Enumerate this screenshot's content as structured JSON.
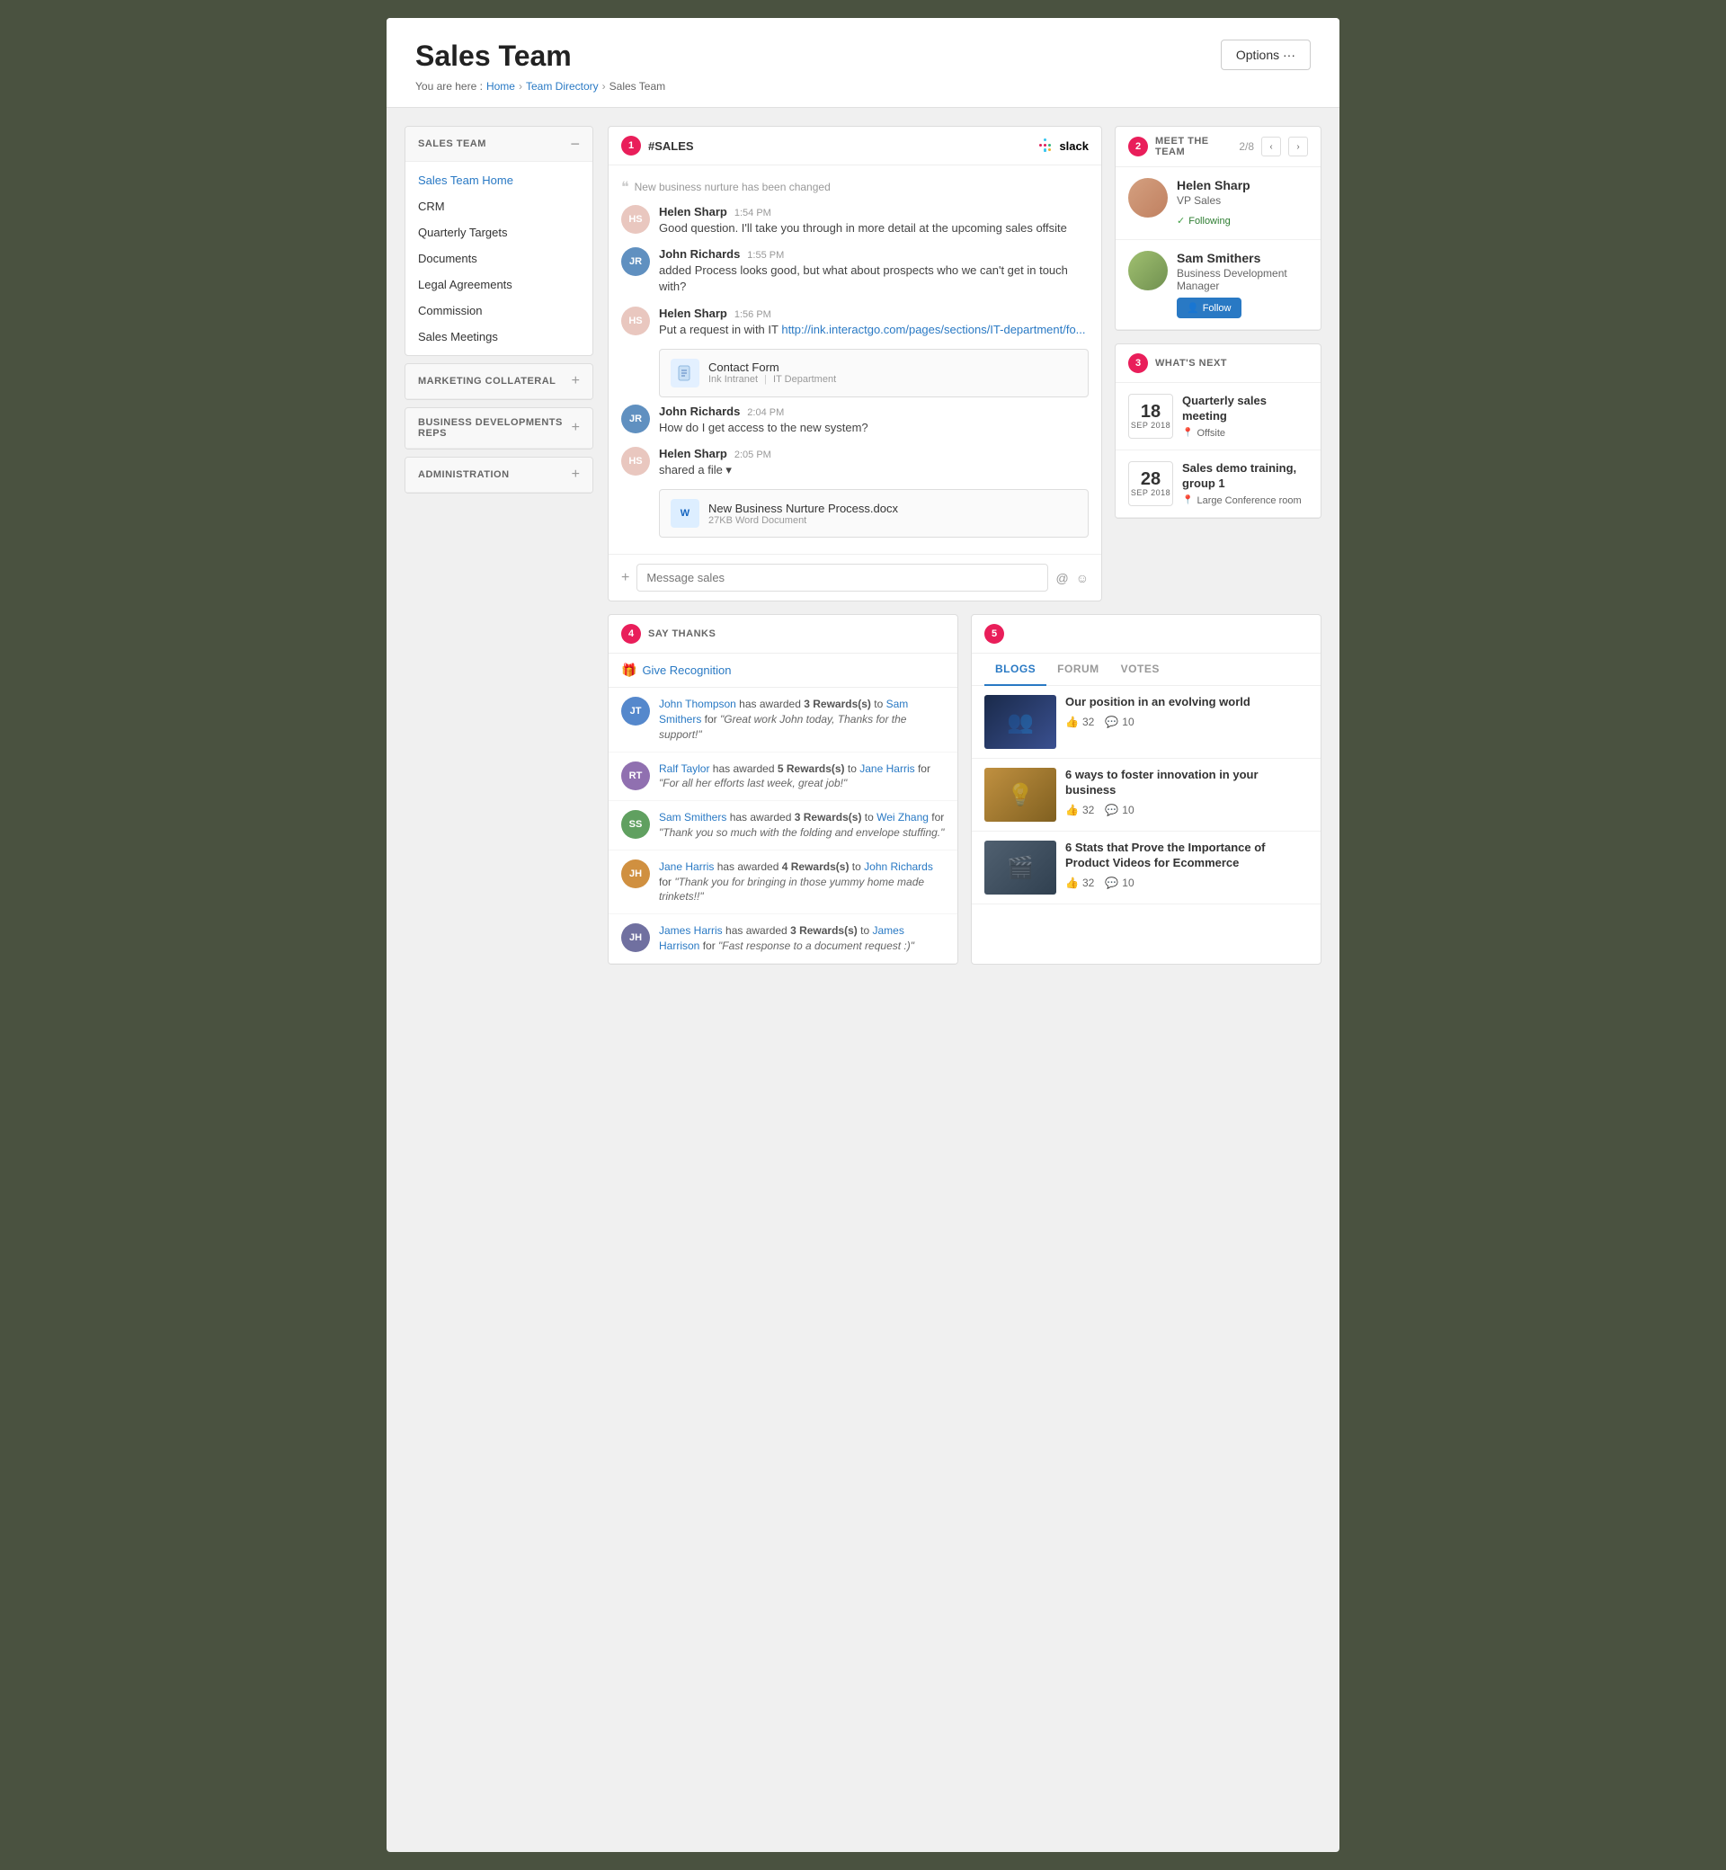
{
  "header": {
    "title": "Sales Team",
    "breadcrumb": {
      "prefix": "You are here :",
      "home": "Home",
      "team_dir": "Team Directory",
      "current": "Sales Team"
    },
    "options_label": "Options ···"
  },
  "sidebar": {
    "sections": [
      {
        "id": "sales-team",
        "title": "SALES TEAM",
        "toggle": "−",
        "items": [
          {
            "label": "Sales Team Home",
            "active": true
          },
          {
            "label": "CRM",
            "active": false
          },
          {
            "label": "Quarterly Targets",
            "active": false
          },
          {
            "label": "Documents",
            "active": false
          },
          {
            "label": "Legal Agreements",
            "active": false
          },
          {
            "label": "Commission",
            "active": false
          },
          {
            "label": "Sales Meetings",
            "active": false
          }
        ]
      },
      {
        "id": "marketing-collateral",
        "title": "MARKETING COLLATERAL",
        "toggle": "+",
        "items": []
      },
      {
        "id": "business-dev",
        "title": "BUSINESS DEVELOPMENTS REPS",
        "toggle": "+",
        "items": []
      },
      {
        "id": "administration",
        "title": "ADMINISTRATION",
        "toggle": "+",
        "items": []
      }
    ]
  },
  "slack": {
    "badge": "1",
    "channel": "#SALES",
    "system_msg": "New business nurture has been changed",
    "messages": [
      {
        "name": "Helen Sharp",
        "time": "1:54 PM",
        "text": "Good question. I'll take you through in more detail at the upcoming sales offsite"
      },
      {
        "name": "John Richards",
        "time": "1:55 PM",
        "text": "added Process looks good, but what about prospects who we can't get in touch with?"
      },
      {
        "name": "Helen Sharp",
        "time": "1:56 PM",
        "text": "Put a request in with IT http://ink.interactgo.com/pages/sections/IT-department/fo..."
      },
      {
        "name": "John Richards",
        "time": "2:04 PM",
        "text": "How do I get access to the new system?"
      },
      {
        "name": "Helen Sharp",
        "time": "2:05 PM",
        "text": "shared a file ▾"
      }
    ],
    "attachment_form": {
      "title": "Contact Form",
      "source": "Ink Intranet",
      "dept": "IT Department"
    },
    "attachment_doc": {
      "title": "New Business Nurture Process.docx",
      "size": "27KB Word Document"
    },
    "message_placeholder": "Message sales"
  },
  "meet_team": {
    "badge": "2",
    "title": "MEET THE TEAM",
    "count": "2/8",
    "members": [
      {
        "name": "Helen Sharp",
        "title": "VP Sales",
        "status": "Following",
        "following": true
      },
      {
        "name": "Sam Smithers",
        "title": "Business Development Manager",
        "status": "Follow",
        "following": false
      }
    ]
  },
  "whats_next": {
    "badge": "3",
    "title": "WHAT'S NEXT",
    "events": [
      {
        "day": "18",
        "month": "SEP 2018",
        "title": "Quarterly sales meeting",
        "location": "Offsite"
      },
      {
        "day": "28",
        "month": "SEP 2018",
        "title": "Sales demo training, group 1",
        "location": "Large Conference room"
      }
    ]
  },
  "say_thanks": {
    "badge": "4",
    "title": "SAY THANKS",
    "give_label": "Give Recognition",
    "rewards": [
      {
        "giver": "John Thompson",
        "count": "3",
        "recipient": "Sam Smithers",
        "reason": "\"Great work John today, Thanks for the support!\""
      },
      {
        "giver": "Ralf Taylor",
        "count": "5",
        "recipient": "Jane Harris",
        "reason": "\"For all her efforts last week, great job!\""
      },
      {
        "giver": "Sam Smithers",
        "count": "3",
        "recipient": "Wei Zhang",
        "reason": "\"Thank you so much with the folding and envelope stuffing.\""
      },
      {
        "giver": "Jane Harris",
        "count": "4",
        "recipient": "John Richards",
        "reason": "\"Thank you for bringing in those yummy home made trinkets!!\""
      },
      {
        "giver": "James Harris",
        "count": "3",
        "recipient": "James Harrison",
        "reason": "\"Fast response to a document request :)\""
      }
    ]
  },
  "blogs": {
    "badge": "5",
    "tabs": [
      "BLOGS",
      "FORUM",
      "VOTES"
    ],
    "active_tab": "BLOGS",
    "posts": [
      {
        "title": "Our position in an evolving world",
        "likes": "32",
        "comments": "10"
      },
      {
        "title": "6 ways to foster innovation in your business",
        "likes": "32",
        "comments": "10"
      },
      {
        "title": "6 Stats that Prove the Importance of Product Videos for Ecommerce",
        "likes": "32",
        "comments": "10"
      }
    ]
  }
}
